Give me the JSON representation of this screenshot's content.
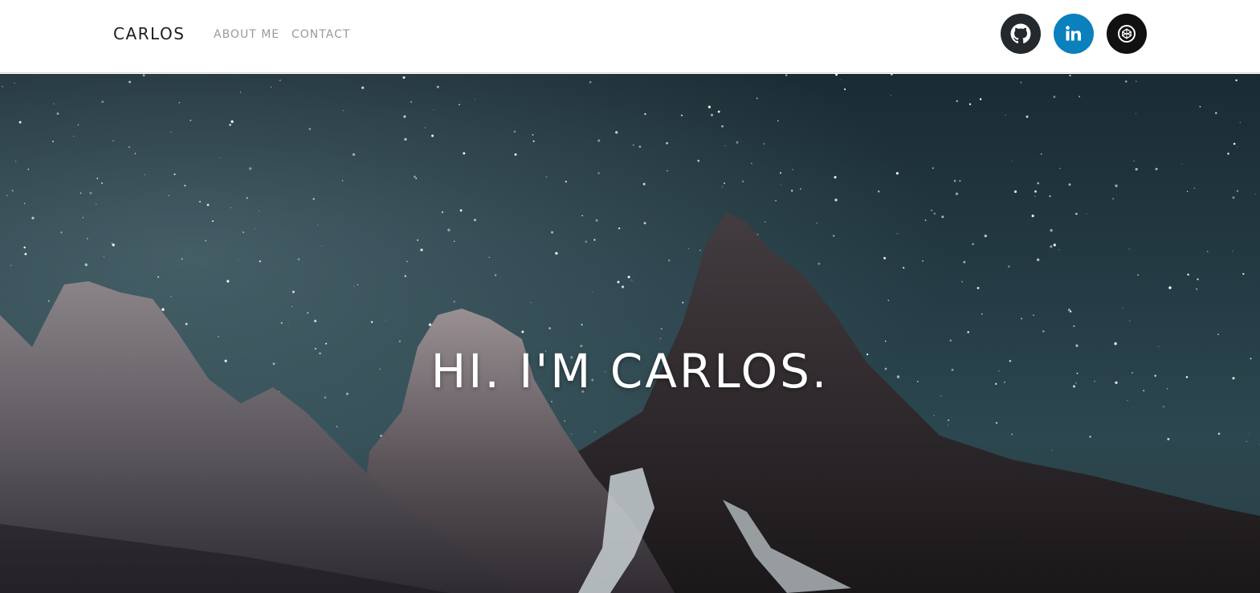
{
  "navbar": {
    "brand": "CARLOS",
    "links": [
      {
        "label": "ABOUT ME"
      },
      {
        "label": "CONTACT"
      }
    ],
    "social": [
      {
        "icon": "github-icon",
        "color": "#24292e"
      },
      {
        "icon": "linkedin-icon",
        "color": "#0a80bd"
      },
      {
        "icon": "codepen-icon",
        "color": "#111111"
      }
    ]
  },
  "hero": {
    "title": "HI. I'M CARLOS."
  }
}
